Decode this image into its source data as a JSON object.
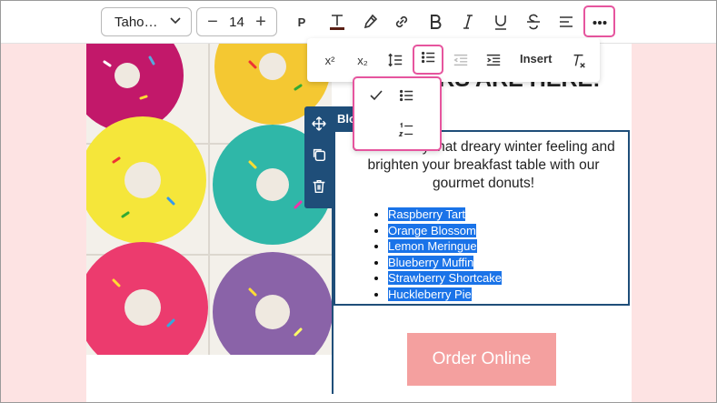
{
  "toolbar": {
    "font_family": "Taho…",
    "font_size": "14",
    "paragraph_label": "P",
    "icons": [
      "text-color-icon",
      "highlight-icon",
      "link-icon",
      "bold-icon",
      "italic-icon",
      "underline-icon",
      "strikethrough-icon",
      "align-icon",
      "more-icon"
    ]
  },
  "toolbar2": {
    "superscript": "x²",
    "subscript": "x₂",
    "insert_label": "Insert",
    "icons": [
      "superscript-icon",
      "subscript-icon",
      "line-height-icon",
      "list-icon",
      "outdent-icon",
      "indent-icon",
      "clear-format-icon"
    ]
  },
  "list_dropdown": {
    "items": [
      {
        "name": "bullet-list",
        "selected": true
      },
      {
        "name": "numbered-list",
        "selected": false
      }
    ]
  },
  "block": {
    "label": "Block",
    "heading": "FLAVORS ARE HERE!",
    "paragraph": "Chase away that dreary winter feeling and brighten your breakfast table with our gourmet donuts!",
    "flavors": [
      "Raspberry Tart",
      "Orange Blossom",
      "Lemon Meringue",
      "Blueberry Muffin",
      "Strawberry Shortcake",
      "Huckleberry Pie"
    ],
    "button_label": "Order Online"
  },
  "colors": {
    "accent_pink": "#e6559e",
    "block_blue": "#1f4e79",
    "selection": "#1a73e8",
    "button": "#f4a09f",
    "background": "#fde3e3"
  }
}
